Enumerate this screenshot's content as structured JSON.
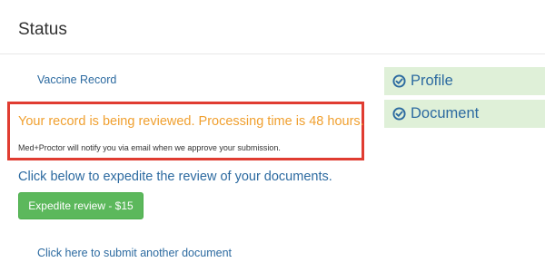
{
  "page": {
    "title": "Status"
  },
  "main": {
    "vaccine_record_link": "Vaccine Record",
    "review_status": "Your record is being reviewed. Processing time is 48 hours.",
    "notify_text": "Med+Proctor will notify you via email when we approve your submission.",
    "expedite_prompt": "Click below to expedite the review of your documents.",
    "expedite_button": "Expedite review - $15",
    "submit_another_link": "Click here to submit another document"
  },
  "sidebar": {
    "items": [
      {
        "label": "Profile",
        "icon": "check-circle-icon"
      },
      {
        "label": "Document",
        "icon": "check-circle-icon"
      }
    ]
  },
  "colors": {
    "link": "#2c6aa0",
    "warning_text": "#f0a030",
    "button_green": "#5cb85c",
    "sidebar_bg": "#dff0d8",
    "highlight_border": "#e03c31"
  }
}
